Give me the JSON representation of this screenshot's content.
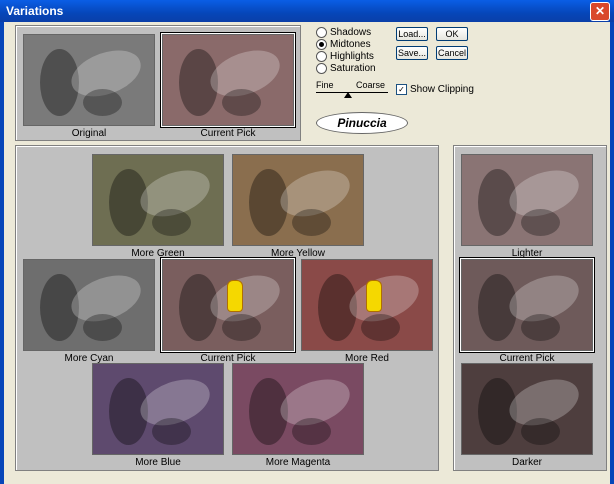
{
  "window": {
    "title": "Variations",
    "close_glyph": "✕"
  },
  "top_previews": [
    {
      "label": "Original",
      "color": "#7a7a7a",
      "selected": false
    },
    {
      "label": "Current Pick",
      "color": "#8a6a6a",
      "selected": true
    }
  ],
  "tone_options": [
    {
      "label": "Shadows",
      "selected": false
    },
    {
      "label": "Midtones",
      "selected": true
    },
    {
      "label": "Highlights",
      "selected": false
    },
    {
      "label": "Saturation",
      "selected": false
    }
  ],
  "buttons": {
    "load": "Load...",
    "ok": "OK",
    "save": "Save...",
    "cancel": "Cancel"
  },
  "slider": {
    "fine_label": "Fine",
    "coarse_label": "Coarse",
    "level": 0.55
  },
  "show_clipping": {
    "label": "Show Clipping",
    "checked": true
  },
  "logo": {
    "text": "Pinuccia"
  },
  "color_grid": [
    {
      "label": "More Green",
      "color": "#6e6e52"
    },
    {
      "label": "More Yellow",
      "color": "#8a6e4e"
    },
    {
      "label": "More Cyan",
      "color": "#6e6e6e"
    },
    {
      "label": "Current Pick",
      "color": "#7a5e5e",
      "selected": true
    },
    {
      "label": "More Red",
      "color": "#8a4a48"
    },
    {
      "label": "More Blue",
      "color": "#5e4a6e"
    },
    {
      "label": "More Magenta",
      "color": "#7a4a62"
    }
  ],
  "brightness": [
    {
      "label": "Lighter",
      "color": "#8a7474"
    },
    {
      "label": "Current Pick",
      "color": "#6e5a5a",
      "selected": true
    },
    {
      "label": "Darker",
      "color": "#4e3e3e"
    }
  ]
}
